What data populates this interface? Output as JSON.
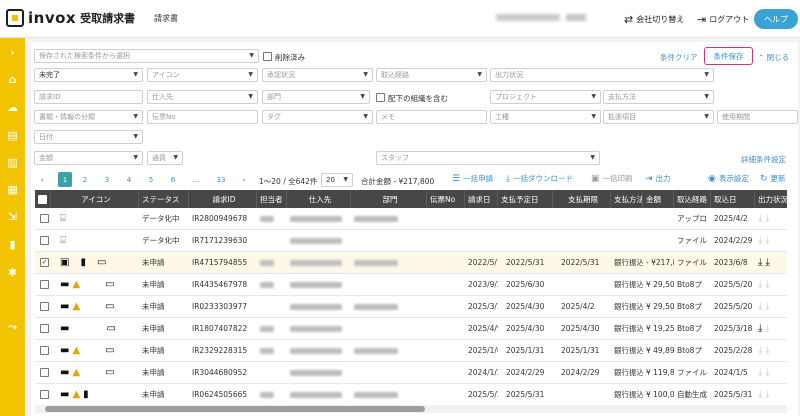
{
  "header": {
    "logo_text": "invox",
    "logo_sub": "受取請求書",
    "page": "請求書",
    "switch_label": "会社切り替え",
    "logout_label": "ログアウト",
    "help_label": "ヘルプ"
  },
  "filters": {
    "saved_search_placeholder": "保存された検索条件から選択",
    "deleted_label": "削除済み",
    "clear_label": "条件クリア",
    "save_label": "条件保存",
    "close_label": "閉じる",
    "status_value": "未完了",
    "icon_placeholder": "アイコン",
    "approval_placeholder": "承認状況",
    "route_placeholder": "取込経路",
    "output_placeholder": "出力状況",
    "request_id_placeholder": "請求ID",
    "vendor_placeholder": "仕入先",
    "dept_placeholder": "部門",
    "sub_org_label": "配下の組織を含む",
    "project_placeholder": "プロジェクト",
    "payment_placeholder": "支払方法",
    "doc_class_placeholder": "書類・情報の分類",
    "slip_placeholder": "伝票No",
    "tag_placeholder": "タグ",
    "memo_placeholder": "メモ",
    "process_placeholder": "工種",
    "ext_placeholder": "拡張項目",
    "period_placeholder": "使用期間",
    "date_placeholder": "日付",
    "amount_placeholder": "金額",
    "currency_placeholder": "通貨",
    "staff_placeholder": "スタッフ",
    "detail_label": "詳細条件設定"
  },
  "pagination": {
    "pages": [
      "1",
      "2",
      "3",
      "4",
      "5",
      "6",
      "...",
      "33"
    ],
    "range": "1〜20 / 全642件",
    "per_page": "20",
    "total": "合計金額 - ¥217,800"
  },
  "actions": {
    "bulk_apply": "一括申請",
    "bulk_download": "一括ダウンロード",
    "bulk_print": "一括印刷",
    "output": "出力",
    "display": "表示設定",
    "refresh": "更新"
  },
  "table": {
    "headers": [
      "アイコン",
      "ステータス",
      "請求ID",
      "担当者",
      "仕入先",
      "部門",
      "伝票No",
      "請求日",
      "支払予定日",
      "支払期限",
      "支払方法",
      "金額",
      "取込経路",
      "取込日",
      "出力状況"
    ],
    "rows": [
      {
        "status": "データ化中",
        "id": "IR2800949678",
        "req_date": "",
        "pay_plan": "",
        "pay_limit": "",
        "method": "",
        "amount": "",
        "route": "アップロ",
        "import": "2025/4/2",
        "checked": false
      },
      {
        "status": "データ化中",
        "id": "IR7171239630",
        "req_date": "",
        "pay_plan": "",
        "pay_limit": "",
        "method": "",
        "amount": "",
        "route": "ファイル",
        "import": "2024/2/29",
        "checked": false
      },
      {
        "status": "未申請",
        "id": "IR4715794855",
        "req_date": "2022/5/1",
        "pay_plan": "2022/5/31",
        "pay_limit": "2022/5/31",
        "method": "銀行振込",
        "amount": "- ¥217,8",
        "route": "ファイル",
        "import": "2023/6/8",
        "checked": true
      },
      {
        "status": "未申請",
        "id": "IR4435467978",
        "req_date": "2023/9/30",
        "pay_plan": "2025/6/30",
        "pay_limit": "",
        "method": "銀行振込",
        "amount": "¥ 29,50",
        "route": "Bto8プ",
        "import": "2025/5/20",
        "checked": false
      },
      {
        "status": "未申請",
        "id": "IR0233303977",
        "req_date": "2025/3/18",
        "pay_plan": "2025/4/30",
        "pay_limit": "2025/4/2",
        "method": "銀行振込",
        "amount": "¥ 29,50",
        "route": "Bto8プ",
        "import": "2025/5/20",
        "checked": false
      },
      {
        "status": "未申請",
        "id": "IR1807407822",
        "req_date": "2025/4/9",
        "pay_plan": "2025/4/30",
        "pay_limit": "2025/4/30",
        "method": "銀行振込",
        "amount": "¥ 19,25",
        "route": "Bto8プ",
        "import": "2025/3/18",
        "checked": false
      },
      {
        "status": "未申請",
        "id": "IR2329228315",
        "req_date": "2025/1/6",
        "pay_plan": "2025/1/31",
        "pay_limit": "2025/1/31",
        "method": "銀行振込",
        "amount": "¥ 49,89",
        "route": "Bto8プ",
        "import": "2025/2/28",
        "checked": false
      },
      {
        "status": "未申請",
        "id": "IR3044680952",
        "req_date": "2024/1/31",
        "pay_plan": "2024/2/29",
        "pay_limit": "2024/2/29",
        "method": "銀行振込",
        "amount": "¥ 119,8",
        "route": "ファイル",
        "import": "2024/1/5",
        "checked": false
      },
      {
        "status": "未申請",
        "id": "IR0624505665",
        "req_date": "2025/5/31",
        "pay_plan": "2025/5/31",
        "pay_limit": "",
        "method": "銀行振込",
        "amount": "¥ 100,0",
        "route": "自動生成",
        "import": "2025/5/31",
        "checked": false
      }
    ]
  },
  "colors": {
    "sidebar": "#f2c300",
    "accent": "#3a8fcf",
    "header_row": "#474747",
    "help": "#39a3d6",
    "highlight": "#e0306a"
  }
}
